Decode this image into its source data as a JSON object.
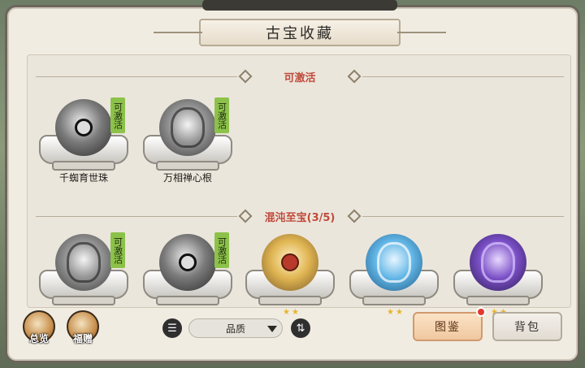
{
  "title": "古宝收藏",
  "sections": {
    "activatable": {
      "label": "可激活"
    },
    "chaos": {
      "label": "混沌至宝(3/5)"
    }
  },
  "activatable_items": [
    {
      "name": "千蜘育世珠",
      "badge": "可激活",
      "orb": "grey-eye"
    },
    {
      "name": "万相禅心根",
      "badge": "可激活",
      "orb": "grey-wisp"
    }
  ],
  "chaos_items": [
    {
      "badge": "可激活",
      "orb": "grey-wisp",
      "stars": 0
    },
    {
      "badge": "可激活",
      "orb": "grey-eye",
      "stars": 0
    },
    {
      "orb": "gold-demon",
      "stars": 2
    },
    {
      "orb": "blue-cloud",
      "stars": 2
    },
    {
      "orb": "purple-vortex",
      "stars": 2
    }
  ],
  "bottom_bar": {
    "overview_label": "总览",
    "gift_label": "福赠",
    "sort_dropdown_value": "品质",
    "gallery_tab": "图鉴",
    "bag_tab": "背包"
  }
}
